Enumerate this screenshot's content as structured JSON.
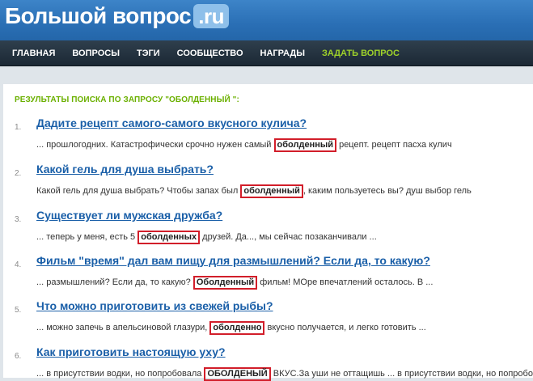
{
  "header": {
    "logo_text": "Большой вопрос",
    "logo_badge": ".ru"
  },
  "nav": {
    "items": [
      "ГЛАВНАЯ",
      "ВОПРОСЫ",
      "ТЭГИ",
      "СООБЩЕСТВО",
      "НАГРАДЫ",
      "ЗАДАТЬ ВОПРОС"
    ]
  },
  "results": {
    "title": "РЕЗУЛЬТАТЫ ПОИСКА ПО ЗАПРОСУ \"ОБОЛДЕННЫЙ \":",
    "items": [
      {
        "num": "1.",
        "title": "Дадите рецепт самого-самого вкусного кулича?",
        "before": "... прошлогодних. Катастрофически срочно нужен самый ",
        "highlight": "оболденный",
        "after": " рецепт. рецепт пасха кулич"
      },
      {
        "num": "2.",
        "title": "Какой гель для душа выбрать?",
        "before": "Какой гель для душа выбрать? Чтобы запах был ",
        "highlight": "оболденный",
        "after": ", каким пользуетесь вы? душ выбор гель"
      },
      {
        "num": "3.",
        "title": "Существует ли мужская дружба?",
        "before": "... теперь у меня, есть 5 ",
        "highlight": "оболденных",
        "after": " друзей. Да..., мы сейчас позаканчивали ..."
      },
      {
        "num": "4.",
        "title": "Фильм \"время\" дал вам пищу для размышлений? Если да, то какую?",
        "before": "... размышлений? Если да, то какую? ",
        "highlight": "Оболденный",
        "after": " фильм! МОре впечатлений осталось. В ..."
      },
      {
        "num": "5.",
        "title": "Что можно приготовить из свежей рыбы?",
        "before": "... можно запечь в апельсиновой глазури, ",
        "highlight": "оболденно",
        "after": " вкусно получается, и легко готовить ..."
      },
      {
        "num": "6.",
        "title": "Как приготовить настоящую уху?",
        "before": "... в присутствии водки, но попробовала ",
        "highlight": "ОБОЛДЕНЫЙ",
        "after": " ВКУС.За уши не оттащишь ... в присутствии водки, но попробовала"
      }
    ]
  }
}
